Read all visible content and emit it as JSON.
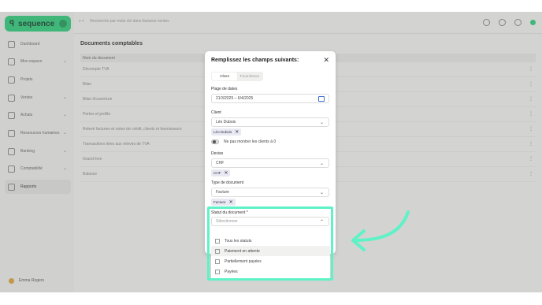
{
  "sidebar": {
    "brand": "sequence",
    "items": [
      {
        "label": "Dashboard",
        "chevron": false
      },
      {
        "label": "Mon espace",
        "chevron": true
      },
      {
        "label": "Projets",
        "chevron": false
      },
      {
        "label": "Ventes",
        "chevron": true
      },
      {
        "label": "Achats",
        "chevron": true
      },
      {
        "label": "Ressources humaines",
        "chevron": true
      },
      {
        "label": "Banking",
        "chevron": true
      },
      {
        "label": "Comptabilité",
        "chevron": true
      },
      {
        "label": "Rapports",
        "chevron": false,
        "active": true
      }
    ],
    "user": "Emma Rogers"
  },
  "topbar": {
    "search_placeholder": "Recherche par mots clé dans factures ventes"
  },
  "page": {
    "title": "Documents comptables",
    "column": "Nom du document",
    "rows": [
      "Décompte TVA",
      "Bilan",
      "Bilan d'ouverture",
      "Pertes et profits",
      "Relevé factures et notes de crédit, clients et fournisseurs",
      "Transactions liées aux relevés de TVA",
      "Grand livre",
      "Balance"
    ]
  },
  "modal": {
    "title": "Remplissez les champs suivants:",
    "close": "✕",
    "tabs": [
      "Client",
      "Fournisseur"
    ],
    "date_label": "Plage de dates",
    "date_value": "21/3/2025 – 6/4/2025",
    "client_label": "Client",
    "client_value": "Léo Dubois",
    "client_chip": "Léo Dubois",
    "toggle_label": "Ne pas montrer les clients à 0",
    "devise_label": "Devise",
    "devise_value": "CHF",
    "devise_chip": "CHF",
    "type_label": "Type de document",
    "type_value": "Facture",
    "type_chip": "Facture",
    "statut_label": "Statut du document *",
    "statut_placeholder": "Sélectionner",
    "statut_options": [
      "Tous les statuts",
      "Paiement en attente",
      "Partiellement payées",
      "Payées"
    ]
  },
  "colors": {
    "brand": "#2bd07a",
    "highlight": "#5ef2c6"
  }
}
